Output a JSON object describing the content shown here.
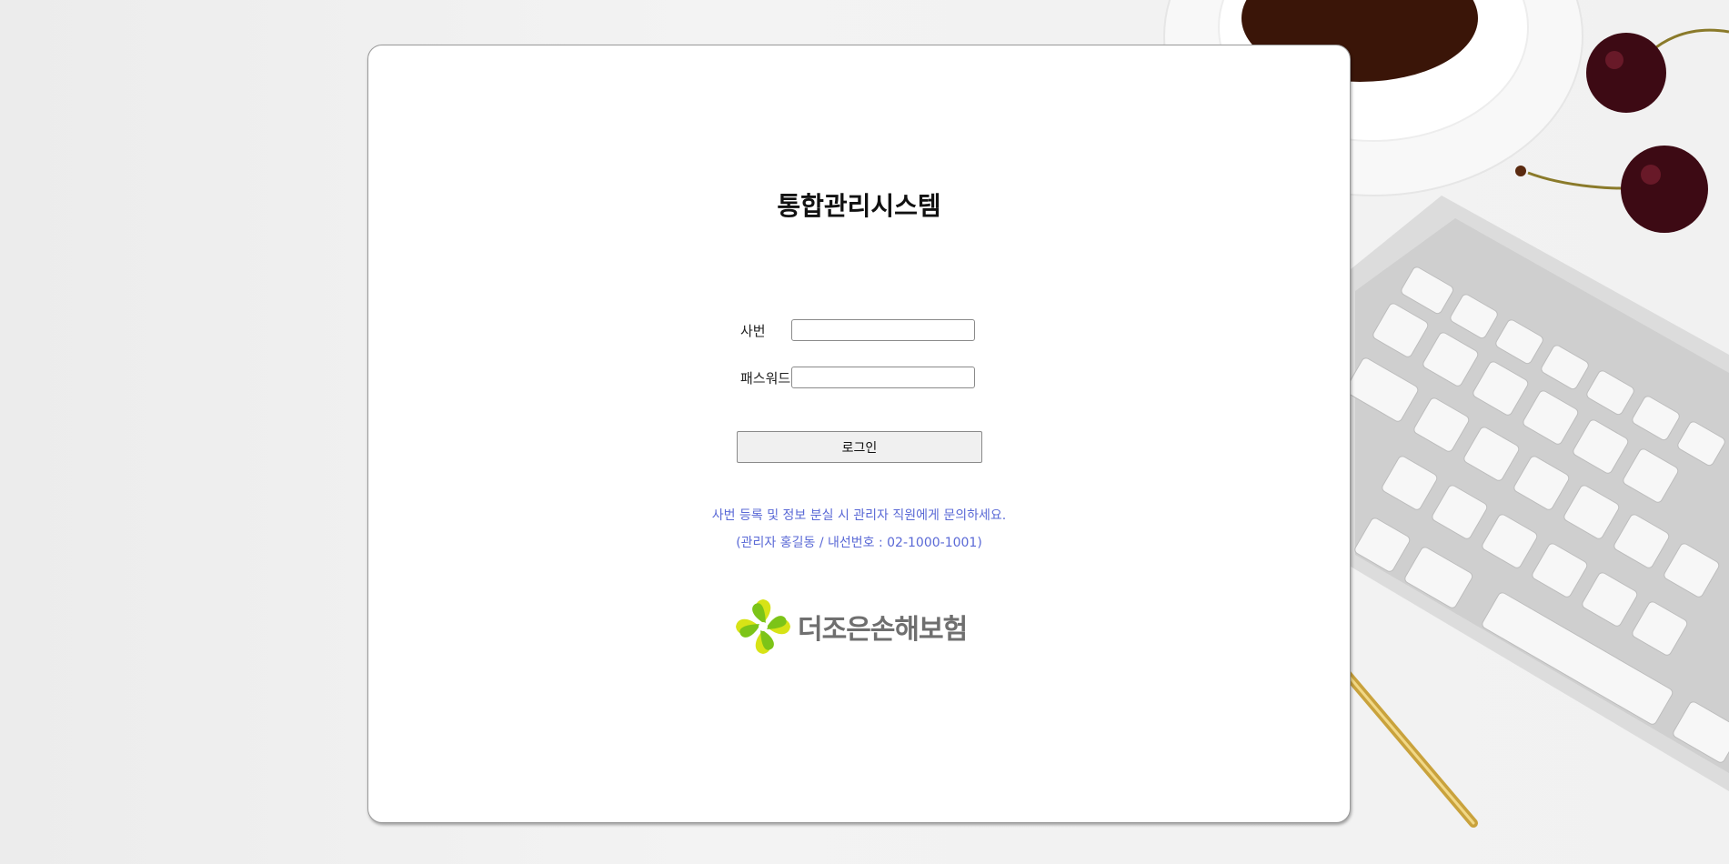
{
  "page": {
    "title": "통합관리시스템"
  },
  "form": {
    "id_label": "사번",
    "id_value": "",
    "password_label": "패스워드",
    "password_value": "",
    "login_label": "로그인"
  },
  "notice": {
    "line1": "사번 등록 및 정보 분실 시 관리자 직원에게 문의하세요.",
    "line2": "(관리자 홍길동 / 내선번호 : 02-1000-1001)"
  },
  "brand": {
    "name": "더조은손해보험",
    "logo_icon": "clover-logo-icon"
  },
  "colors": {
    "notice_text": "#5a69d6",
    "logo_green": "#7cc418",
    "logo_yellow": "#d7e316",
    "logo_text": "#6f6f6f"
  },
  "background": {
    "decor_items": [
      "coffee-cup-icon",
      "cherry-icon",
      "keyboard-icon",
      "pen-icon"
    ]
  }
}
